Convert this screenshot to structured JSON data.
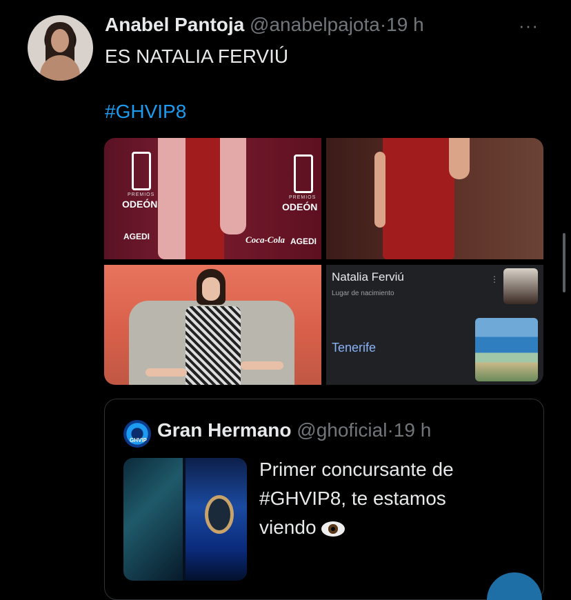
{
  "tweet": {
    "author_name": "Anabel Pantoja",
    "author_handle": "@anabelpajota",
    "separator": "·",
    "time": "19 h",
    "more_label": "···",
    "text": "ES NATALIA FERVIÚ",
    "hashtag": "#GHVIP8",
    "media": {
      "photo1": {
        "brand": "ODEÓN",
        "premios": "PREMIOS",
        "sponsor": "AGEDI",
        "sponsor2": "Coca-Cola"
      },
      "photo2": {},
      "photo3": {},
      "knowledge_panel": {
        "title": "Natalia Ferviú",
        "subtitle": "Lugar de nacimiento",
        "more": "⋮",
        "place": "Tenerife"
      }
    }
  },
  "quoted_tweet": {
    "author_name": "Gran Hermano",
    "author_handle": "@ghoficial",
    "separator": "·",
    "time": "19 h",
    "avatar_text": "GHVIP",
    "text": "Primer concursante de #GHVIP8, te estamos viendo"
  },
  "colors": {
    "link": "#1d9bf0",
    "muted": "#71767b",
    "background": "#000000"
  }
}
